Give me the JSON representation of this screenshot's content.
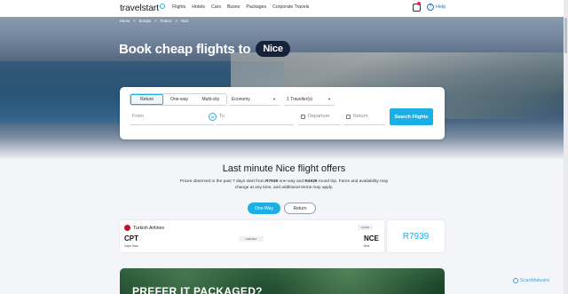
{
  "header": {
    "logo": "travelstart",
    "nav": [
      "Flights",
      "Hotels",
      "Cars",
      "Buses",
      "Packages",
      "Corporate Travels"
    ],
    "help": "Help"
  },
  "breadcrumb": [
    "Home",
    ">",
    "Europe",
    ">",
    "France",
    ">",
    "Nice"
  ],
  "hero": {
    "title": "Book cheap flights to",
    "city": "Nice"
  },
  "search": {
    "trip_types": [
      "Return",
      "One-way",
      "Multi-city"
    ],
    "cabin": "Economy",
    "travellers": "1 Traveller(s)",
    "from_placeholder": "From",
    "to_placeholder": "To",
    "departure_placeholder": "Departure",
    "return_placeholder": "Return",
    "button": "Search Flights"
  },
  "offers": {
    "title": "Last minute Nice flight offers",
    "desc_prefix": "Prices observed in the past 7 days start from ",
    "oneway_price": "R7939",
    "desc_mid": " one-way and ",
    "return_price": "R4939",
    "desc_suffix": " round trip. Fares and availability may change at any time, and additional terms may apply.",
    "toggle_oneway": "One-Way",
    "toggle_return": "Return",
    "card": {
      "airline": "Turkish Airlines",
      "class": "CLASS",
      "from_code": "CPT",
      "from_city": "Cape Town",
      "trip": "ONE WAY",
      "to_code": "NCE",
      "to_city": "Nice",
      "price": "R7939"
    }
  },
  "promo": {
    "text": "PREFER IT PACKAGED?"
  },
  "watermark": "ScanMalware",
  "colors": {
    "accent": "#1ab0e6",
    "dark_pill": "#16213a"
  }
}
